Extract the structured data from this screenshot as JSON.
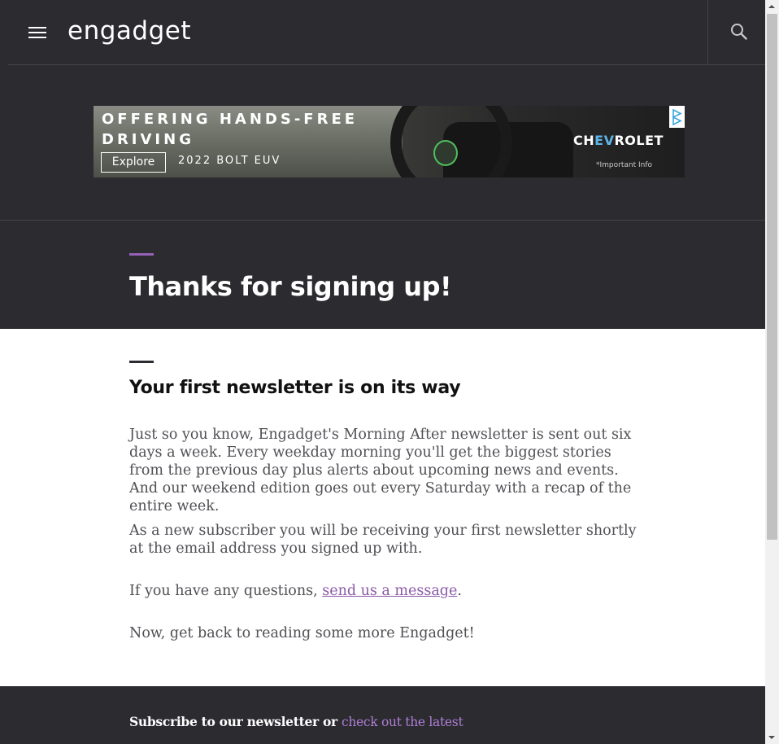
{
  "header": {
    "logo_text": "engadget",
    "menu_icon": "hamburger-menu-icon",
    "search_icon": "search-icon"
  },
  "ad": {
    "headline": "OFFERING HANDS-FREE DRIVING",
    "cta_label": "Explore",
    "model": "2022 BOLT EUV",
    "brand_part1": "CH",
    "brand_part2": "EV",
    "brand_part3": "ROLET",
    "important_info": "*Important Info",
    "adchoices_icon": "adchoices-icon"
  },
  "main": {
    "title": "Thanks for signing up!",
    "subheading": "Your first newsletter is on its way",
    "paragraph1": "Just so you know, Engadget's Morning After newsletter is sent out six days a week. Every weekday morning you'll get the biggest stories from the previous day plus alerts about upcoming news and events. And our weekend edition goes out every Saturday with a recap of the entire week.",
    "paragraph2": "As a new subscriber you will be receiving your first newsletter shortly at the email address you signed up with.",
    "paragraph3_prefix": "If you have any questions, ",
    "paragraph3_link": "send us a message",
    "paragraph3_suffix": ".",
    "paragraph4": "Now, get back to reading some more Engadget!"
  },
  "footer": {
    "text": "Subscribe to our newsletter or ",
    "link": "check out the latest"
  },
  "colors": {
    "background_dark": "#2b2b30",
    "accent_purple": "#9361b6",
    "link_purple": "#8a5aa8",
    "body_text": "#505055"
  }
}
